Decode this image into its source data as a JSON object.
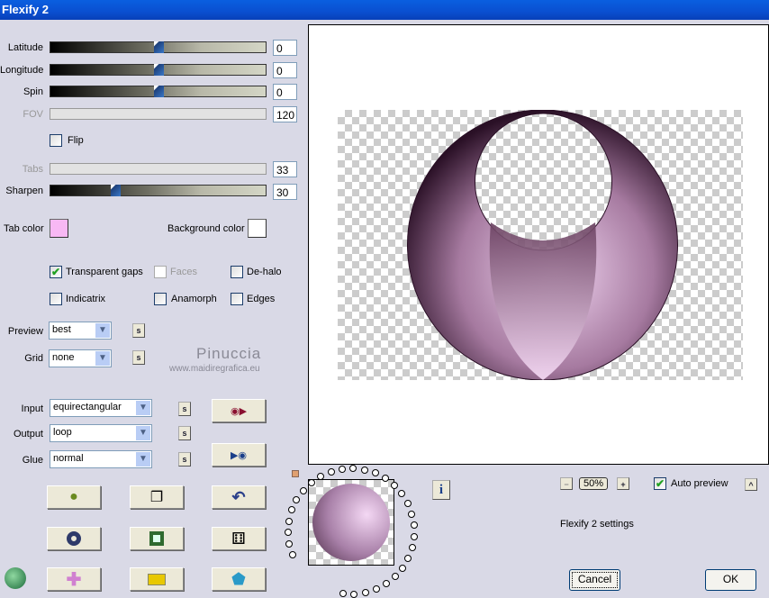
{
  "window": {
    "title": "Flexify 2"
  },
  "sliders": [
    {
      "label": "Latitude",
      "value": "0",
      "fraction": 0.5,
      "enabled": true
    },
    {
      "label": "Longitude",
      "value": "0",
      "fraction": 0.5,
      "enabled": true
    },
    {
      "label": "Spin",
      "value": "0",
      "fraction": 0.5,
      "enabled": true
    },
    {
      "label": "FOV",
      "value": "120",
      "enabled": false
    }
  ],
  "flip": {
    "label": "Flip",
    "checked": false
  },
  "tabs": {
    "label": "Tabs",
    "value": "33"
  },
  "sharpen": {
    "label": "Sharpen",
    "value": "30",
    "fraction": 0.3
  },
  "colors": {
    "tab_label": "Tab color",
    "tab_color": "#f8b8f4",
    "bg_label": "Background color",
    "bg_color": "#ffffff"
  },
  "options": {
    "transparent_gaps": "Transparent gaps",
    "faces": "Faces",
    "dehalo": "De-halo",
    "indicatrix": "Indicatrix",
    "anamorph": "Anamorph",
    "edges": "Edges"
  },
  "preview_select": {
    "label": "Preview",
    "value": "best"
  },
  "grid_select": {
    "label": "Grid",
    "value": "none"
  },
  "input_select": {
    "label": "Input",
    "value": "equirectangular"
  },
  "output_select": {
    "label": "Output",
    "value": "loop"
  },
  "glue_select": {
    "label": "Glue",
    "value": "normal"
  },
  "s_label": "s",
  "watermark": {
    "name": "Pinuccia",
    "url": "www.maidiregrafica.eu"
  },
  "zoom": {
    "value": "50%",
    "minus": "−",
    "plus": "+"
  },
  "auto_preview": {
    "label": "Auto preview",
    "checked": true
  },
  "collapse": "^",
  "status": "Flexify 2 settings",
  "buttons": {
    "cancel": "Cancel",
    "ok": "OK",
    "info": "i"
  },
  "colors_theme": {
    "accent": "#0a4fd0",
    "shape_dark": "#3a1a32",
    "shape_light": "#f0d0f0"
  }
}
